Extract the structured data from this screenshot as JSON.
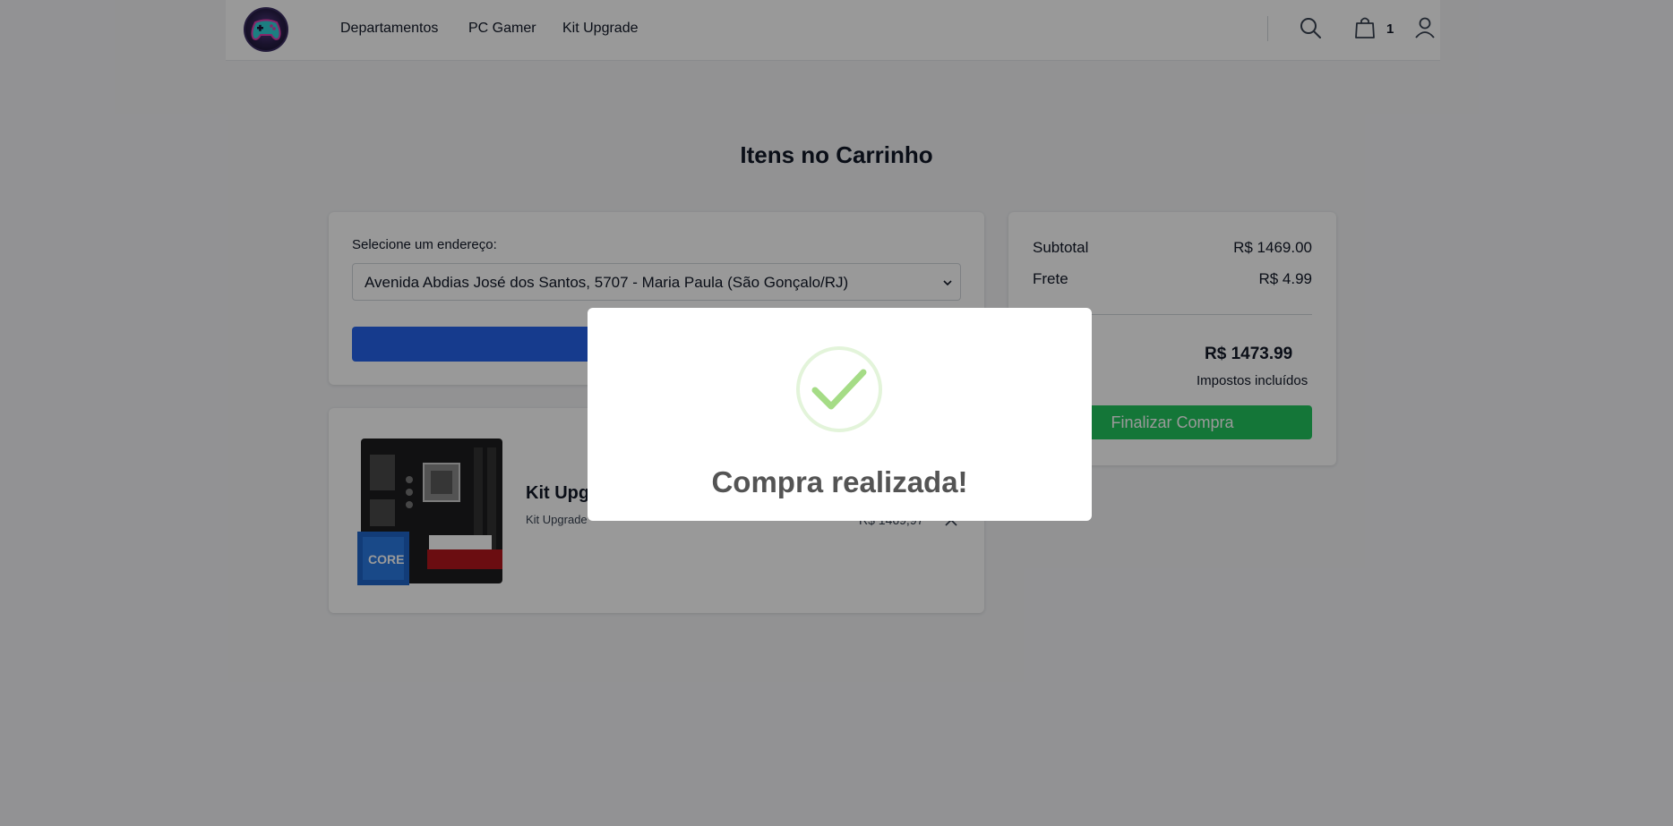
{
  "header": {
    "logo_icon": "gamepad-logo-icon",
    "nav": [
      "Departamentos",
      "PC Gamer",
      "Kit Upgrade"
    ],
    "icons": [
      "search-icon",
      "shopping-bag-icon",
      "user-icon"
    ],
    "cart_count": "1"
  },
  "main": {
    "title": "Itens no Carrinho",
    "address": {
      "label": "Selecione um endereço:",
      "selected": "Avenida Abdias José dos Santos, 5707 - Maria Paula (São Gonçalo/RJ)"
    },
    "item": {
      "name": "Kit Upg",
      "category": "Kit Upgrade",
      "price": "R$ 1469,97"
    }
  },
  "summary": {
    "subtotal_label": "Subtotal",
    "subtotal_value": "R$ 1469.00",
    "shipping_label": "Frete",
    "shipping_value": "R$ 4.99",
    "total_label": "",
    "total_value": "R$ 1473.99",
    "tax_note": "Impostos incluídos",
    "checkout_label": "Finalizar Compra"
  },
  "modal": {
    "icon": "success-check-icon",
    "title": "Compra realizada!"
  },
  "colors": {
    "primary": "#2563eb",
    "success": "#22c55e",
    "check": "#a5dc86"
  }
}
